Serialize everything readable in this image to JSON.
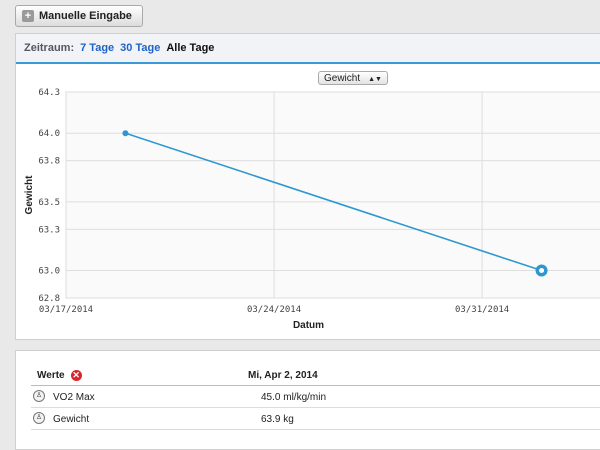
{
  "toolbar": {
    "manual_entry_label": "Manuelle Eingabe",
    "plus_glyph": "+"
  },
  "range": {
    "label": "Zeitraum:",
    "options": [
      {
        "label": "7 Tage",
        "active": false
      },
      {
        "label": "30 Tage",
        "active": false
      },
      {
        "label": "Alle Tage",
        "active": true
      }
    ]
  },
  "metric_select": {
    "selected": "Gewicht"
  },
  "chart_data": {
    "type": "line",
    "title": "",
    "xlabel": "Datum",
    "ylabel": "Gewicht",
    "x_ticks": [
      "03/17/2014",
      "03/24/2014",
      "03/31/2014"
    ],
    "x_range": [
      "2014-03-17",
      "2014-04-04"
    ],
    "ylim": [
      62.8,
      64.3
    ],
    "y_ticks": [
      "62.8",
      "63.0",
      "63.3",
      "63.5",
      "63.8",
      "64.0",
      "64.3"
    ],
    "grid": true,
    "series": [
      {
        "color": "#2f97d0",
        "points": [
          {
            "x": "2014-03-19",
            "y": 64.0
          },
          {
            "x": "2014-04-02",
            "y": 63.0
          }
        ]
      }
    ]
  },
  "table": {
    "header_values": "Werte",
    "header_date": "Mi, Apr 2, 2014",
    "rows": [
      {
        "name": "VO2 Max",
        "value": "45.0 ml/kg/min"
      },
      {
        "name": "Gewicht",
        "value": "63.9 kg"
      }
    ]
  }
}
